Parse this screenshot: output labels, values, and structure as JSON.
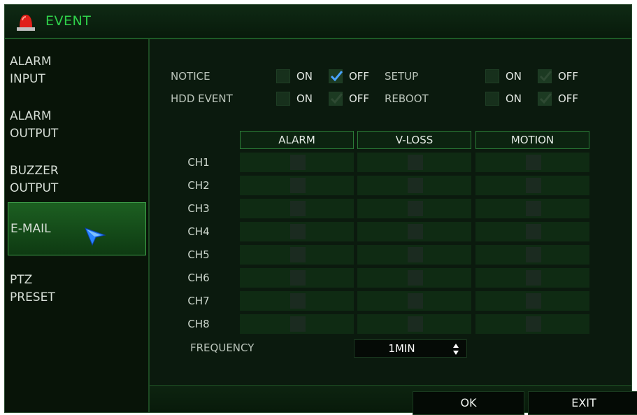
{
  "window": {
    "title": "EVENT"
  },
  "sidebar": {
    "items": [
      {
        "line1": "ALARM",
        "line2": "INPUT",
        "active": false
      },
      {
        "line1": "ALARM",
        "line2": "OUTPUT",
        "active": false
      },
      {
        "line1": "BUZZER",
        "line2": "OUTPUT",
        "active": false
      },
      {
        "line1": "E-MAIL",
        "line2": "",
        "active": true
      },
      {
        "line1": "PTZ",
        "line2": "PRESET",
        "active": false
      }
    ]
  },
  "options": [
    {
      "label": "NOTICE",
      "on_label": "ON",
      "off_label": "OFF",
      "value": "OFF"
    },
    {
      "label": "SETUP",
      "on_label": "ON",
      "off_label": "OFF",
      "value": "OFF"
    },
    {
      "label": "HDD EVENT",
      "on_label": "ON",
      "off_label": "OFF",
      "value": "OFF"
    },
    {
      "label": "REBOOT",
      "on_label": "ON",
      "off_label": "OFF",
      "value": "OFF"
    }
  ],
  "table": {
    "columns": [
      "ALARM",
      "V-LOSS",
      "MOTION"
    ],
    "rows": [
      "CH1",
      "CH2",
      "CH3",
      "CH4",
      "CH5",
      "CH6",
      "CH7",
      "CH8"
    ]
  },
  "frequency": {
    "label": "FREQUENCY",
    "value": "1MIN"
  },
  "footer": {
    "ok_label": "OK",
    "exit_label": "EXIT"
  },
  "colors": {
    "accent": "#2fd14a",
    "background": "#0b1a0e",
    "check": "#4aa3ff"
  }
}
